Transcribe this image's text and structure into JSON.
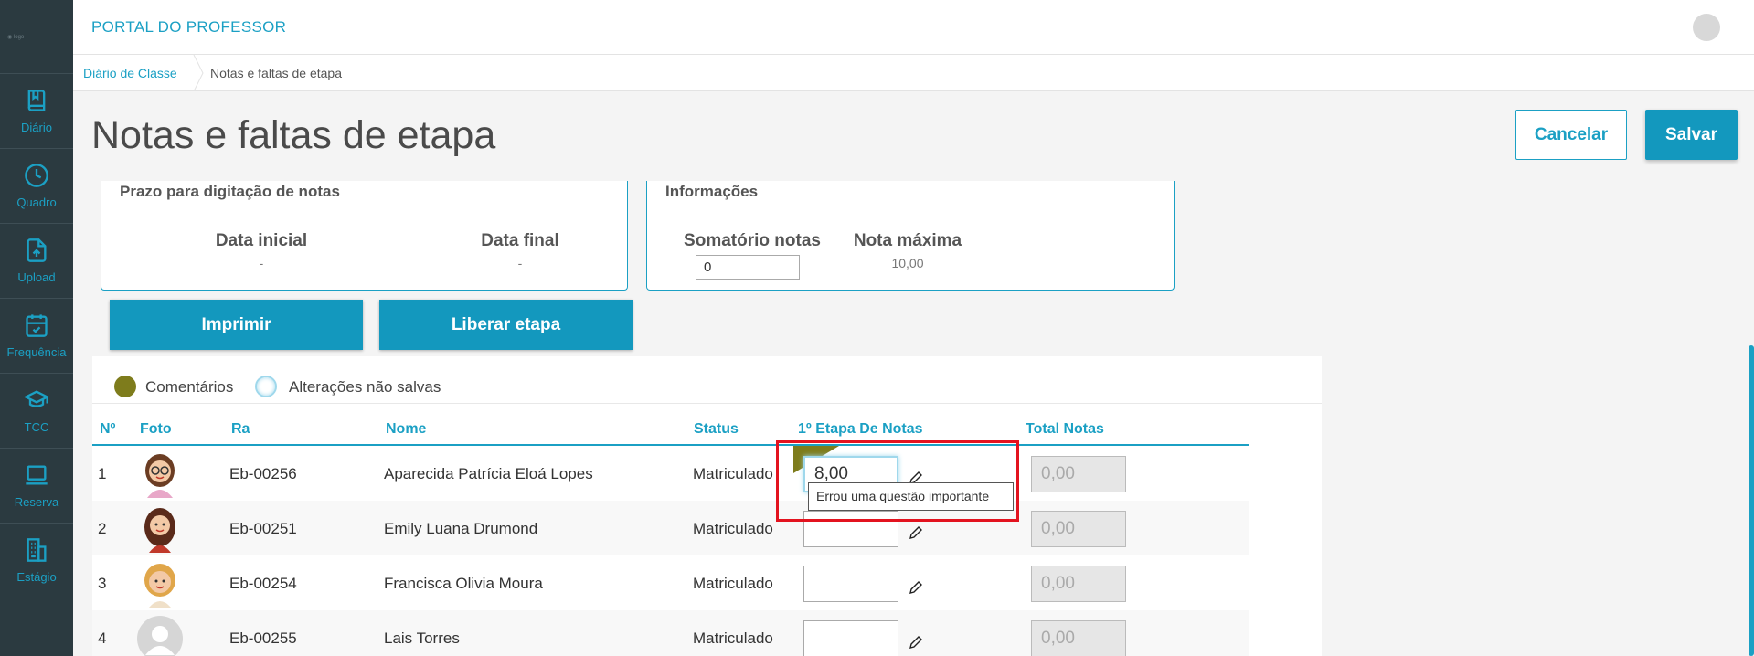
{
  "app": {
    "title": "PORTAL DO PROFESSOR",
    "logo_text": "◉ logo"
  },
  "sidebar": {
    "items": [
      {
        "label": "Diário",
        "icon": "book-icon"
      },
      {
        "label": "Quadro",
        "icon": "clock-icon"
      },
      {
        "label": "Upload",
        "icon": "upload-file-icon"
      },
      {
        "label": "Frequência",
        "icon": "calendar-check-icon"
      },
      {
        "label": "TCC",
        "icon": "graduation-cap-icon"
      },
      {
        "label": "Reserva",
        "icon": "laptop-icon"
      },
      {
        "label": "Estágio",
        "icon": "building-icon"
      }
    ],
    "accent": "#1ba0c4",
    "background": "#2b3a40"
  },
  "breadcrumb": {
    "root": "Diário de Classe",
    "current": "Notas e faltas de etapa"
  },
  "page": {
    "title": "Notas e faltas de etapa",
    "cancel_label": "Cancelar",
    "save_label": "Salvar"
  },
  "deadline_box": {
    "title": "Prazo para digitação de notas",
    "start_label": "Data inicial",
    "start_value": "-",
    "end_label": "Data final",
    "end_value": "-"
  },
  "info_box": {
    "title": "Informações",
    "sum_label": "Somatório notas",
    "sum_value": "0",
    "max_label": "Nota máxima",
    "max_value": "10,00"
  },
  "actions": {
    "print_label": "Imprimir",
    "release_label": "Liberar etapa"
  },
  "legend": {
    "comments_label": "Comentários",
    "comments_color": "#7e7c1c",
    "unsaved_label": "Alterações não salvas",
    "unsaved_color": "#9fd8ec"
  },
  "table": {
    "headers": [
      "Nº",
      "Foto",
      "Ra",
      "Nome",
      "Status",
      "1º Etapa De Notas",
      "Total Notas"
    ],
    "rows": [
      {
        "num": "1",
        "ra": "Eb-00256",
        "name": "Aparecida Patrícia Eloá Lopes",
        "status": "Matriculado",
        "grade": "8,00",
        "total": "0,00",
        "photo": "avatar-woman-glasses"
      },
      {
        "num": "2",
        "ra": "Eb-00251",
        "name": "Emily Luana Drumond",
        "status": "Matriculado",
        "grade": "",
        "total": "0,00",
        "photo": "avatar-woman-dark-hair"
      },
      {
        "num": "3",
        "ra": "Eb-00254",
        "name": "Francisca Olivia Moura",
        "status": "Matriculado",
        "grade": "",
        "total": "0,00",
        "photo": "avatar-woman-blonde"
      },
      {
        "num": "4",
        "ra": "Eb-00255",
        "name": "Lais Torres",
        "status": "Matriculado",
        "grade": "",
        "total": "0,00",
        "photo": "avatar-placeholder"
      }
    ]
  },
  "tooltip": {
    "text": "Errou uma questão importante"
  }
}
